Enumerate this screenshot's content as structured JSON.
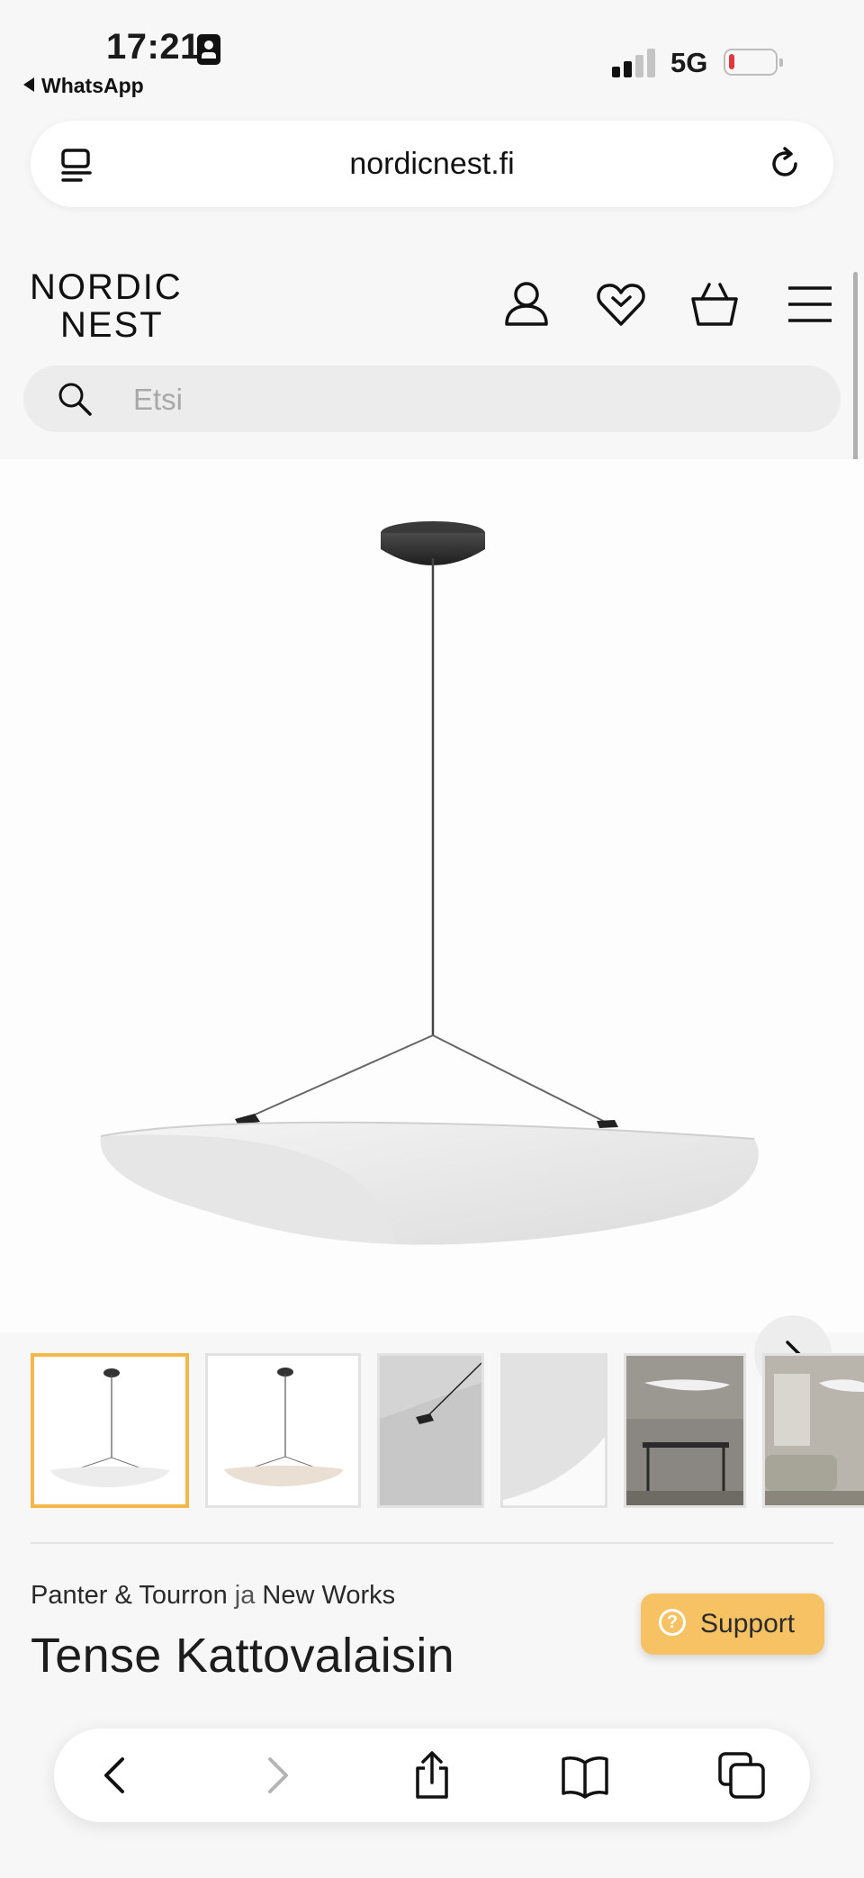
{
  "status_bar": {
    "time": "17:21",
    "back_app": "WhatsApp",
    "network": "5G"
  },
  "browser": {
    "url": "nordicnest.fi"
  },
  "header": {
    "logo_line1": "NORDIC",
    "logo_line2": "NEST"
  },
  "search": {
    "placeholder": "Etsi"
  },
  "product": {
    "brand1": "Panter & Tourron",
    "connector": "ja",
    "brand2": "New Works",
    "title": "Tense Kattovalaisin"
  },
  "support": {
    "label": "Support"
  },
  "colors": {
    "accent_thumb": "#f2b84b",
    "support_bg": "#f7c264",
    "battery_low": "#e0383e"
  }
}
